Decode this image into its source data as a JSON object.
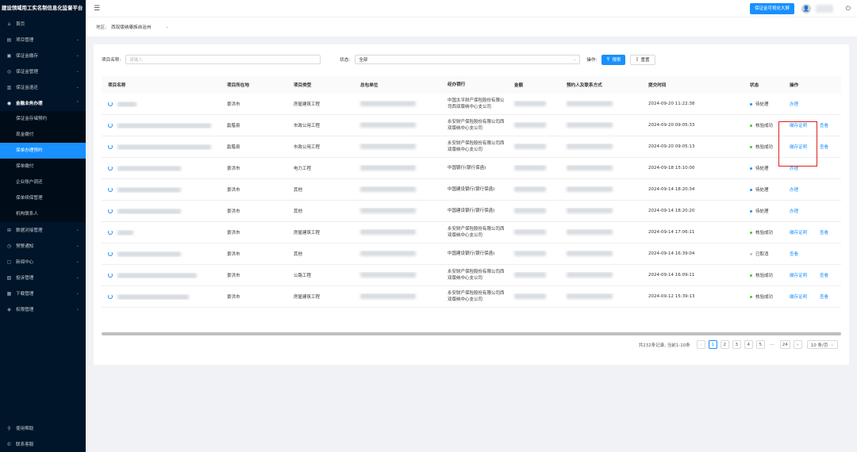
{
  "app": {
    "title": "建设领域用工实名制信息化监督平台"
  },
  "sidebar": {
    "items": [
      {
        "label": "首页",
        "icon": "home-icon",
        "glyph": "⌂",
        "arrow": ""
      },
      {
        "label": "项目管理",
        "icon": "project-icon",
        "glyph": "▤",
        "arrow": "⌄"
      },
      {
        "label": "保证金缴存",
        "icon": "deposit-icon",
        "glyph": "▣",
        "arrow": "⌄"
      },
      {
        "label": "保证金管理",
        "icon": "manage-icon",
        "glyph": "◎",
        "arrow": "⌄"
      },
      {
        "label": "保证金退还",
        "icon": "refund-icon",
        "glyph": "▥",
        "arrow": "⌄"
      },
      {
        "label": "金融业务办理",
        "icon": "finance-icon",
        "glyph": "◉",
        "arrow": "⌃"
      }
    ],
    "sub_items": [
      {
        "label": "保证金存储预约",
        "active": false
      },
      {
        "label": "现金缴付",
        "active": false
      },
      {
        "label": "保单办理预约",
        "active": true
      },
      {
        "label": "保单缴付",
        "active": false
      },
      {
        "label": "企业账户调还",
        "active": false
      },
      {
        "label": "保单续保管理",
        "active": false
      },
      {
        "label": "机构联系人",
        "active": false
      }
    ],
    "items_after": [
      {
        "label": "数据对接管理",
        "icon": "data-icon",
        "glyph": "⊞",
        "arrow": "⌄"
      },
      {
        "label": "预警通知",
        "icon": "alert-icon",
        "glyph": "◷",
        "arrow": "⌄"
      },
      {
        "label": "新闻中心",
        "icon": "news-icon",
        "glyph": "▢",
        "arrow": "⌄"
      },
      {
        "label": "投诉管理",
        "icon": "complaint-icon",
        "glyph": "▧",
        "arrow": "⌄"
      },
      {
        "label": "下载管理",
        "icon": "download-icon",
        "glyph": "▦",
        "arrow": "⌄"
      },
      {
        "label": "权限管理",
        "icon": "permission-icon",
        "glyph": "◈",
        "arrow": "⌄"
      }
    ],
    "bottom": [
      {
        "label": "使用帮助",
        "icon": "help-icon",
        "glyph": "⚲"
      },
      {
        "label": "联系客服",
        "icon": "service-icon",
        "glyph": "✆"
      }
    ]
  },
  "header": {
    "big_screen_button": "保证金可视化大屏",
    "avatar_glyph": "👤",
    "power_glyph": "⏻"
  },
  "region": {
    "label": "地区:",
    "value": "西双版纳傣族自治州"
  },
  "filters": {
    "name_label": "项目名称:",
    "name_placeholder": "请输入",
    "status_label": "状态:",
    "status_value": "全部",
    "ops_label": "操作:",
    "search_button": "搜索",
    "reset_button": "重置"
  },
  "table": {
    "headers": [
      "项目名称",
      "项目所在地",
      "项目类型",
      "总包单位",
      "经办银行",
      "金额",
      "预约人及联系方式",
      "提交时间",
      "状态",
      "操作"
    ],
    "rows": [
      {
        "location": "景洪市",
        "type": "房屋建筑工程",
        "bank": "中国太平财产保险股份有限公司西双版纳中心支公司",
        "time": "2024-09-20 11:22:38",
        "status": "待处理",
        "status_color": "#1890ff",
        "ops": [
          "办理"
        ],
        "name_w": 24,
        "con_w": 70
      },
      {
        "location": "勐腊县",
        "type": "市政公用工程",
        "bank": "永安财产保险股份有限公司西双版纳中心支公司",
        "time": "2024-09-20 09:05:33",
        "status": "核验成功",
        "status_color": "#52c41a",
        "ops": [
          "缴存证明",
          "查看"
        ],
        "name_w": 118,
        "con_w": 70
      },
      {
        "location": "勐腊县",
        "type": "市政公用工程",
        "bank": "永安财产保险股份有限公司西双版纳中心支公司",
        "time": "2024-09-20 09:05:13",
        "status": "核验成功",
        "status_color": "#52c41a",
        "ops": [
          "缴存证明",
          "查看"
        ],
        "name_w": 118,
        "con_w": 70
      },
      {
        "location": "景洪市",
        "type": "电力工程",
        "bank": "中国银行(银行保函)",
        "time": "2024-09-18 15:10:00",
        "status": "待处理",
        "status_color": "#1890ff",
        "ops": [
          "办理"
        ],
        "name_w": 80,
        "con_w": 70
      },
      {
        "location": "景洪市",
        "type": "其他",
        "bank": "中国建设银行(银行保函)",
        "time": "2024-09-14 18:20:34",
        "status": "待处理",
        "status_color": "#1890ff",
        "ops": [
          "办理"
        ],
        "name_w": 80,
        "con_w": 70
      },
      {
        "location": "景洪市",
        "type": "其他",
        "bank": "中国建设银行(银行保函)",
        "time": "2024-09-14 18:20:20",
        "status": "待处理",
        "status_color": "#1890ff",
        "ops": [
          "办理"
        ],
        "name_w": 80,
        "con_w": 70
      },
      {
        "location": "景洪市",
        "type": "房屋建筑工程",
        "bank": "永安财产保险股份有限公司西双版纳中心支公司",
        "time": "2024-09-14 17:06:11",
        "status": "核验成功",
        "status_color": "#52c41a",
        "ops": [
          "缴存证明",
          "查看"
        ],
        "name_w": 20,
        "con_w": 70
      },
      {
        "location": "景洪市",
        "type": "其他",
        "bank": "中国建设银行(银行保函)",
        "time": "2024-09-14 16:39:04",
        "status": "已取消",
        "status_color": "#bfbfbf",
        "ops": [
          "查看"
        ],
        "name_w": 80,
        "con_w": 70
      },
      {
        "location": "景洪市",
        "type": "公路工程",
        "bank": "永安财产保险股份有限公司西双版纳中心支公司",
        "time": "2024-09-14 16:09:11",
        "status": "核验成功",
        "status_color": "#52c41a",
        "ops": [
          "缴存证明",
          "查看"
        ],
        "name_w": 100,
        "con_w": 70
      },
      {
        "location": "景洪市",
        "type": "房屋建筑工程",
        "bank": "永安财产保险股份有限公司西双版纳中心支公司",
        "time": "2024-09-12 15:39:13",
        "status": "核验成功",
        "status_color": "#52c41a",
        "ops": [
          "缴存证明",
          "查看"
        ],
        "name_w": 90,
        "con_w": 70
      }
    ]
  },
  "pagination": {
    "summary": "共232条记录, 当前1-10条",
    "prev": "‹",
    "pages": [
      "1",
      "2",
      "3",
      "4",
      "5",
      "···",
      "24"
    ],
    "current": "1",
    "next": "›",
    "page_size": "10 条/页"
  },
  "colors": {
    "primary": "#1890ff",
    "sidebar_bg": "#001529",
    "highlight": "#e02020"
  }
}
